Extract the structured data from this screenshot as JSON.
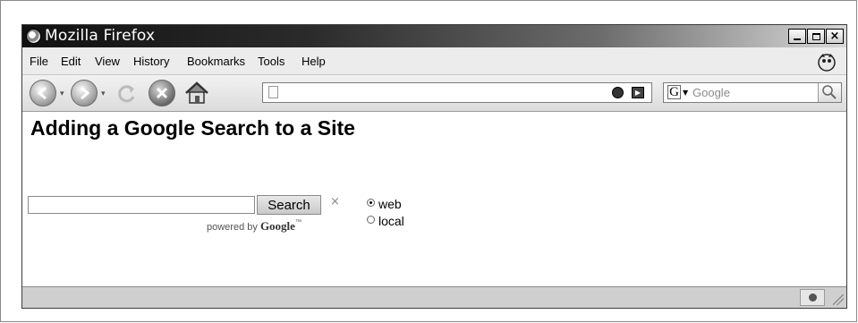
{
  "window": {
    "title": "Mozilla Firefox"
  },
  "window_controls": {
    "minimize": "",
    "maximize": "",
    "close": "×"
  },
  "menu": [
    {
      "label": "File"
    },
    {
      "label": "Edit"
    },
    {
      "label": "View"
    },
    {
      "label": "History"
    },
    {
      "label": "Bookmarks"
    },
    {
      "label": "Tools"
    },
    {
      "label": "Help"
    }
  ],
  "toolbar": {
    "address_value": "",
    "search_engine_letter": "G",
    "search_placeholder": "Google"
  },
  "page": {
    "heading": "Adding a Google Search to a Site",
    "search_input_value": "",
    "search_button": "Search",
    "clear_glyph": "×",
    "powered_by": "powered by",
    "google_brand": "Google",
    "trademark": "™",
    "radio_options": [
      {
        "label": "web",
        "checked": true
      },
      {
        "label": "local",
        "checked": false
      }
    ]
  },
  "status": {
    "text": ""
  },
  "icons": {
    "back": "back-arrow-icon",
    "forward": "forward-arrow-icon",
    "reload": "reload-icon",
    "stop": "stop-icon",
    "home": "home-icon",
    "throbber": "firefox-throbber-icon"
  }
}
